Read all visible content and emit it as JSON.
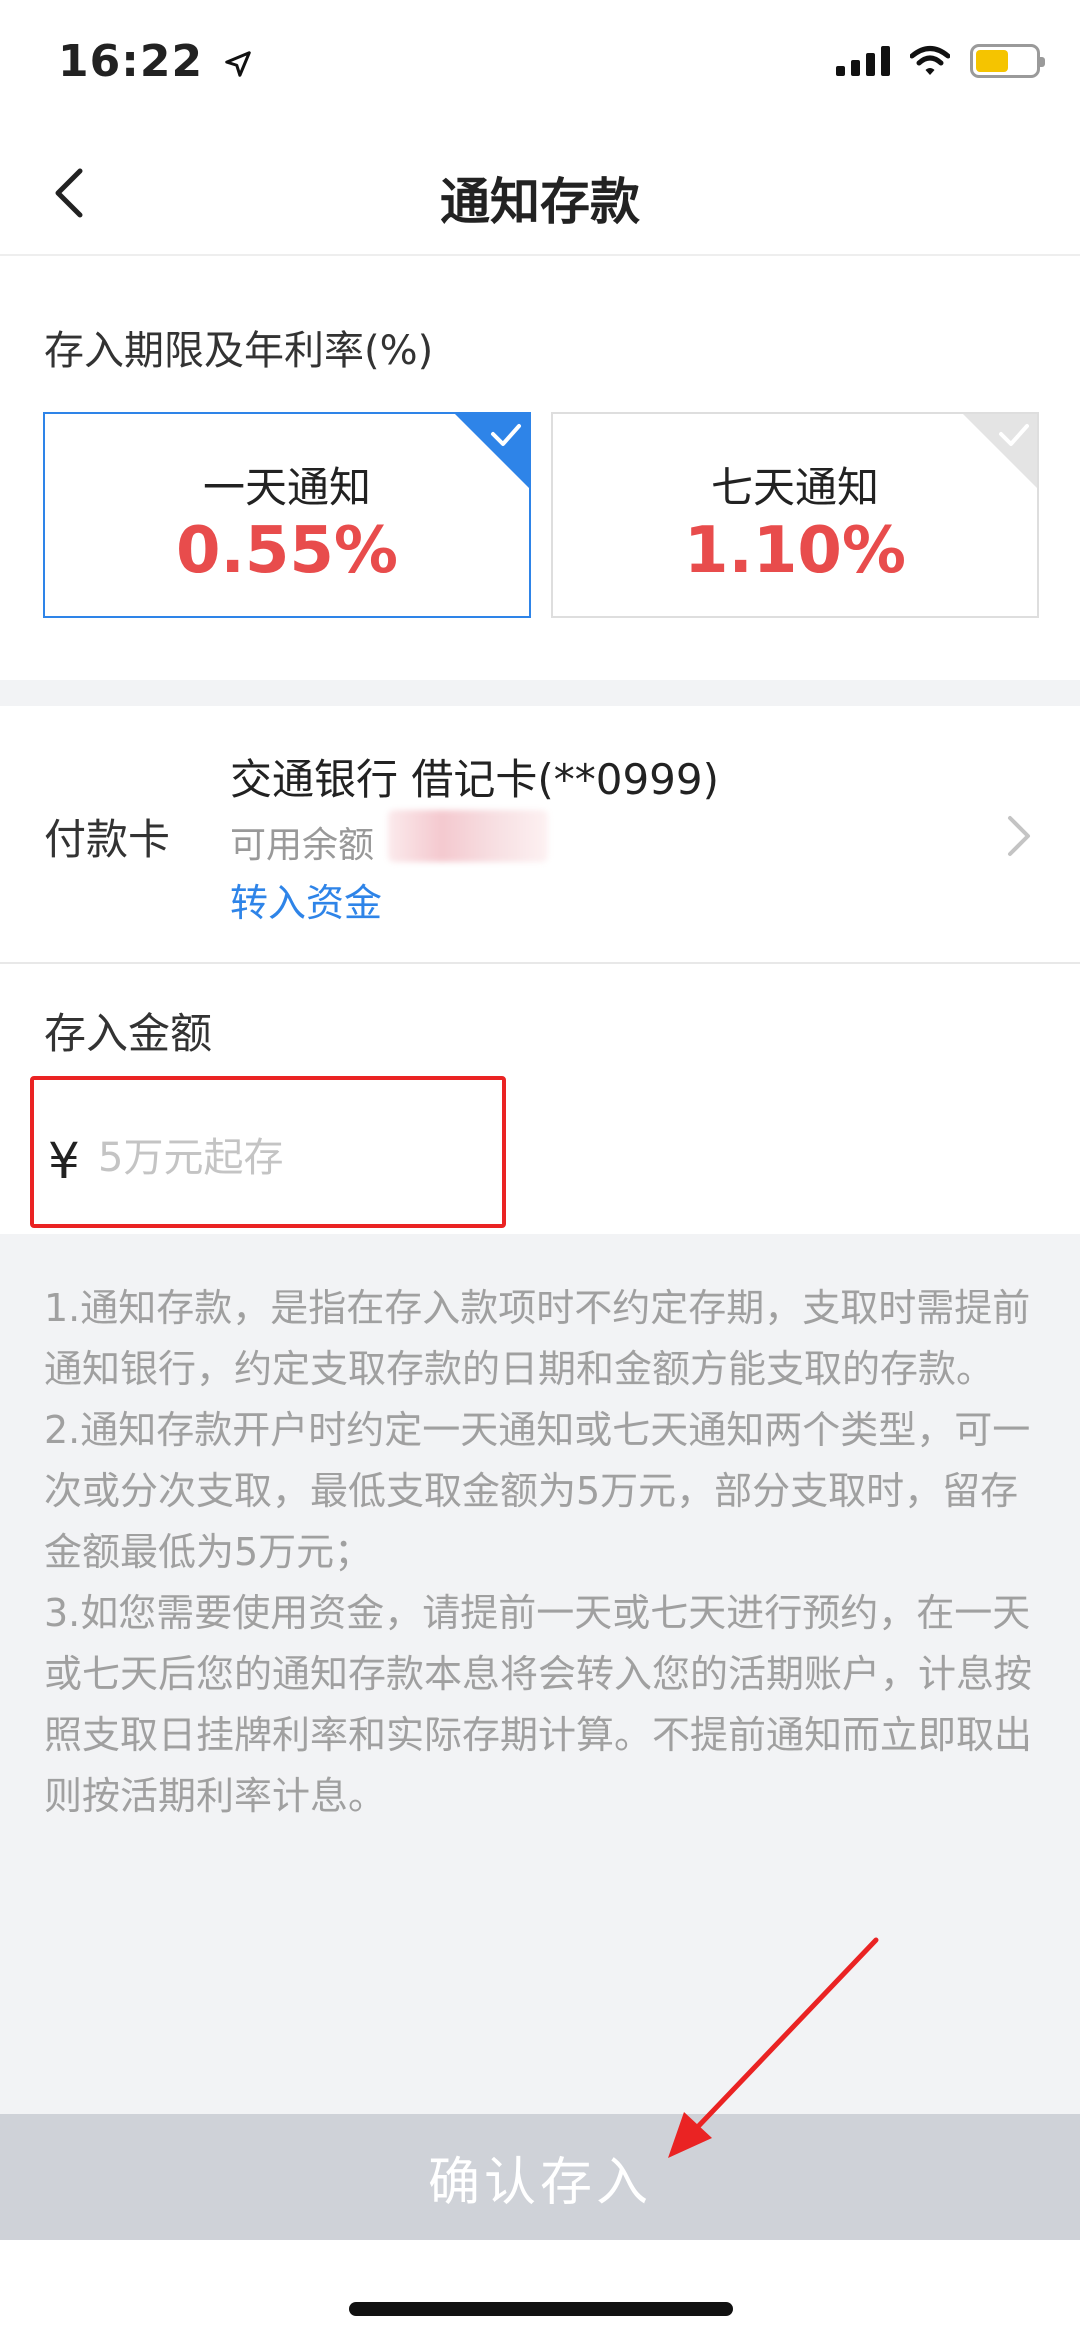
{
  "status_bar": {
    "time": "16:22"
  },
  "nav": {
    "title": "通知存款"
  },
  "period": {
    "label": "存入期限及年利率(%)",
    "options": [
      {
        "name": "一天通知",
        "rate": "0.55%",
        "selected": true
      },
      {
        "name": "七天通知",
        "rate": "1.10%",
        "selected": false
      }
    ]
  },
  "payment": {
    "label": "付款卡",
    "card": "交通银行 借记卡(**0999)",
    "balance_label": "可用余额",
    "transfer_link": "转入资金"
  },
  "amount": {
    "label": "存入金额",
    "currency": "¥",
    "placeholder": "5万元起存",
    "value": ""
  },
  "notes": [
    "1.通知存款，是指在存入款项时不约定存期，支取时需提前通知银行，约定支取存款的日期和金额方能支取的存款。",
    "2.通知存款开户时约定一天通知或七天通知两个类型，可一次或分次支取，最低支取金额为5万元，部分支取时，留存金额最低为5万元；",
    "3.如您需要使用资金，请提前一天或七天进行预约，在一天或七天后您的通知存款本息将会转入您的活期账户，计息按照支取日挂牌利率和实际存期计算。不提前通知而立即取出则按活期利率计息。"
  ],
  "confirm": {
    "label": "确认存入"
  },
  "colors": {
    "accent": "#2e84e8",
    "rate": "#e84c4c",
    "highlight_box": "#ea2323",
    "button_disabled": "#cfd2d8"
  }
}
